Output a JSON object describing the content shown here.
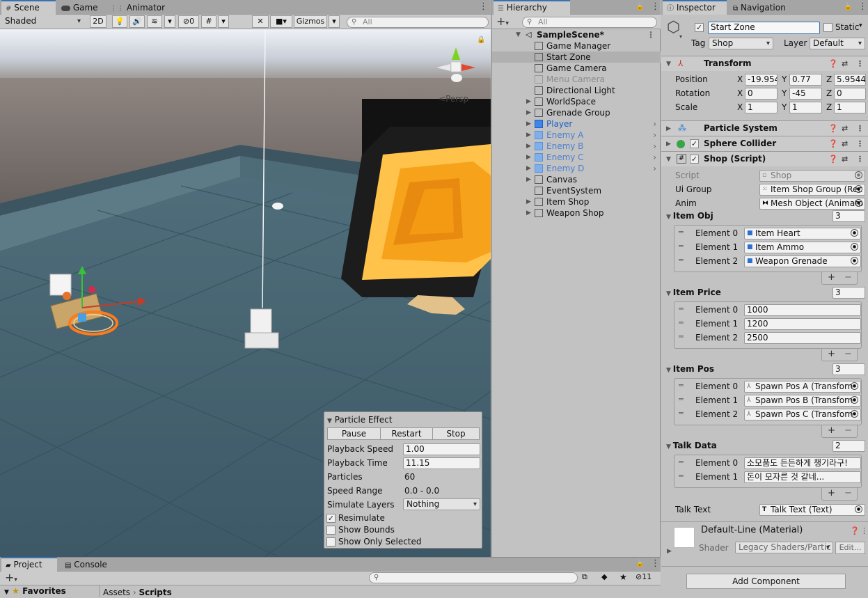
{
  "scene_window": {
    "tabs": [
      {
        "label": "Scene",
        "icon": "hash-icon"
      },
      {
        "label": "Game",
        "icon": "gamepad-icon"
      },
      {
        "label": "Animator",
        "icon": "animator-icon"
      }
    ],
    "toolbar": {
      "shading_mode": "Shaded",
      "mode_2d": "2D",
      "hidden_count": "0",
      "gizmos": "Gizmos",
      "search_placeholder": "All"
    },
    "camera_label": "Persp"
  },
  "particle_effect": {
    "title": "Particle Effect",
    "buttons": [
      "Pause",
      "Restart",
      "Stop"
    ],
    "fields": [
      {
        "label": "Playback Speed",
        "value": "1.00"
      },
      {
        "label": "Playback Time",
        "value": "11.15"
      },
      {
        "label": "Particles",
        "value": "60"
      },
      {
        "label": "Speed Range",
        "value": "0.0 - 0.0"
      },
      {
        "label": "Simulate Layers",
        "value": "Nothing"
      }
    ],
    "checks": [
      {
        "label": "Resimulate",
        "checked": true
      },
      {
        "label": "Show Bounds",
        "checked": false
      },
      {
        "label": "Show Only Selected",
        "checked": false
      }
    ]
  },
  "hierarchy": {
    "tab": "Hierarchy",
    "search_placeholder": "All",
    "scene_name": "SampleScene*",
    "items": [
      {
        "label": "Game Manager",
        "type": "object",
        "expandable": false,
        "style": "normal"
      },
      {
        "label": "Start Zone",
        "type": "object",
        "expandable": false,
        "style": "selected"
      },
      {
        "label": "Game Camera",
        "type": "object",
        "expandable": false,
        "style": "normal"
      },
      {
        "label": "Menu Camera",
        "type": "object",
        "expandable": false,
        "style": "disabled"
      },
      {
        "label": "Directional Light",
        "type": "object",
        "expandable": false,
        "style": "normal"
      },
      {
        "label": "WorldSpace",
        "type": "object",
        "expandable": true,
        "style": "normal"
      },
      {
        "label": "Grenade Group",
        "type": "object",
        "expandable": true,
        "style": "normal"
      },
      {
        "label": "Player",
        "type": "prefab",
        "expandable": true,
        "style": "prefab"
      },
      {
        "label": "Enemy A",
        "type": "prefab",
        "expandable": true,
        "style": "prefab-light"
      },
      {
        "label": "Enemy B",
        "type": "prefab",
        "expandable": true,
        "style": "prefab-light"
      },
      {
        "label": "Enemy C",
        "type": "prefab",
        "expandable": true,
        "style": "prefab-light"
      },
      {
        "label": "Enemy D",
        "type": "prefab",
        "expandable": true,
        "style": "prefab-light"
      },
      {
        "label": "Canvas",
        "type": "object",
        "expandable": true,
        "style": "normal"
      },
      {
        "label": "EventSystem",
        "type": "object",
        "expandable": false,
        "style": "normal"
      },
      {
        "label": "Item Shop",
        "type": "object",
        "expandable": true,
        "style": "normal"
      },
      {
        "label": "Weapon Shop",
        "type": "object",
        "expandable": true,
        "style": "normal"
      }
    ]
  },
  "inspector": {
    "tabs": [
      "Inspector",
      "Navigation"
    ],
    "object_name": "Start Zone",
    "static_label": "Static",
    "tag_label": "Tag",
    "tag_value": "Shop",
    "layer_label": "Layer",
    "layer_value": "Default",
    "transform": {
      "title": "Transform",
      "rows": [
        {
          "label": "Position",
          "x": "-19.954",
          "y": "0.77",
          "z": "5.9544"
        },
        {
          "label": "Rotation",
          "x": "0",
          "y": "-45",
          "z": "0"
        },
        {
          "label": "Scale",
          "x": "1",
          "y": "1",
          "z": "1"
        }
      ],
      "axis_x": "X",
      "axis_y": "Y",
      "axis_z": "Z"
    },
    "particle_system": "Particle System",
    "sphere_collider": "Sphere Collider",
    "shop_script": {
      "title": "Shop (Script)",
      "script_label": "Script",
      "script_value": "Shop",
      "ui_group_label": "Ui Group",
      "ui_group_value": "Item Shop Group (Rec",
      "anim_label": "Anim",
      "anim_value": "Mesh Object (Animato",
      "item_obj": {
        "label": "Item Obj",
        "count": "3",
        "elements": [
          {
            "label": "Element 0",
            "value": "Item Heart"
          },
          {
            "label": "Element 1",
            "value": "Item Ammo"
          },
          {
            "label": "Element 2",
            "value": "Weapon Grenade"
          }
        ]
      },
      "item_price": {
        "label": "Item Price",
        "count": "3",
        "elements": [
          {
            "label": "Element 0",
            "value": "1000"
          },
          {
            "label": "Element 1",
            "value": "1200"
          },
          {
            "label": "Element 2",
            "value": "2500"
          }
        ]
      },
      "item_pos": {
        "label": "Item Pos",
        "count": "3",
        "elements": [
          {
            "label": "Element 0",
            "value": "Spawn Pos A (Transforn"
          },
          {
            "label": "Element 1",
            "value": "Spawn Pos B (Transforn"
          },
          {
            "label": "Element 2",
            "value": "Spawn Pos C (Transforn"
          }
        ]
      },
      "talk_data": {
        "label": "Talk Data",
        "count": "2",
        "elements": [
          {
            "label": "Element 0",
            "value": "소모품도 든든하게 챙기라구!"
          },
          {
            "label": "Element 1",
            "value": "돈이 모자른 것 같네..."
          }
        ]
      },
      "talk_text_label": "Talk Text",
      "talk_text_value": "Talk Text (Text)"
    },
    "material": {
      "name": "Default-Line (Material)",
      "shader_label": "Shader",
      "shader_value": "Legacy Shaders/Partic",
      "edit_label": "Edit..."
    },
    "add_component": "Add Component"
  },
  "project": {
    "tabs": [
      "Project",
      "Console"
    ],
    "favorites": "Favorites",
    "breadcrumb": [
      "Assets",
      "Scripts"
    ],
    "hidden_count": "11"
  },
  "colors": {
    "panel_bg": "#c2c2c2",
    "selected_row": "#b0b0b0",
    "prefab_blue": "#1a5fc7",
    "tab_accent": "#3a72b0"
  }
}
